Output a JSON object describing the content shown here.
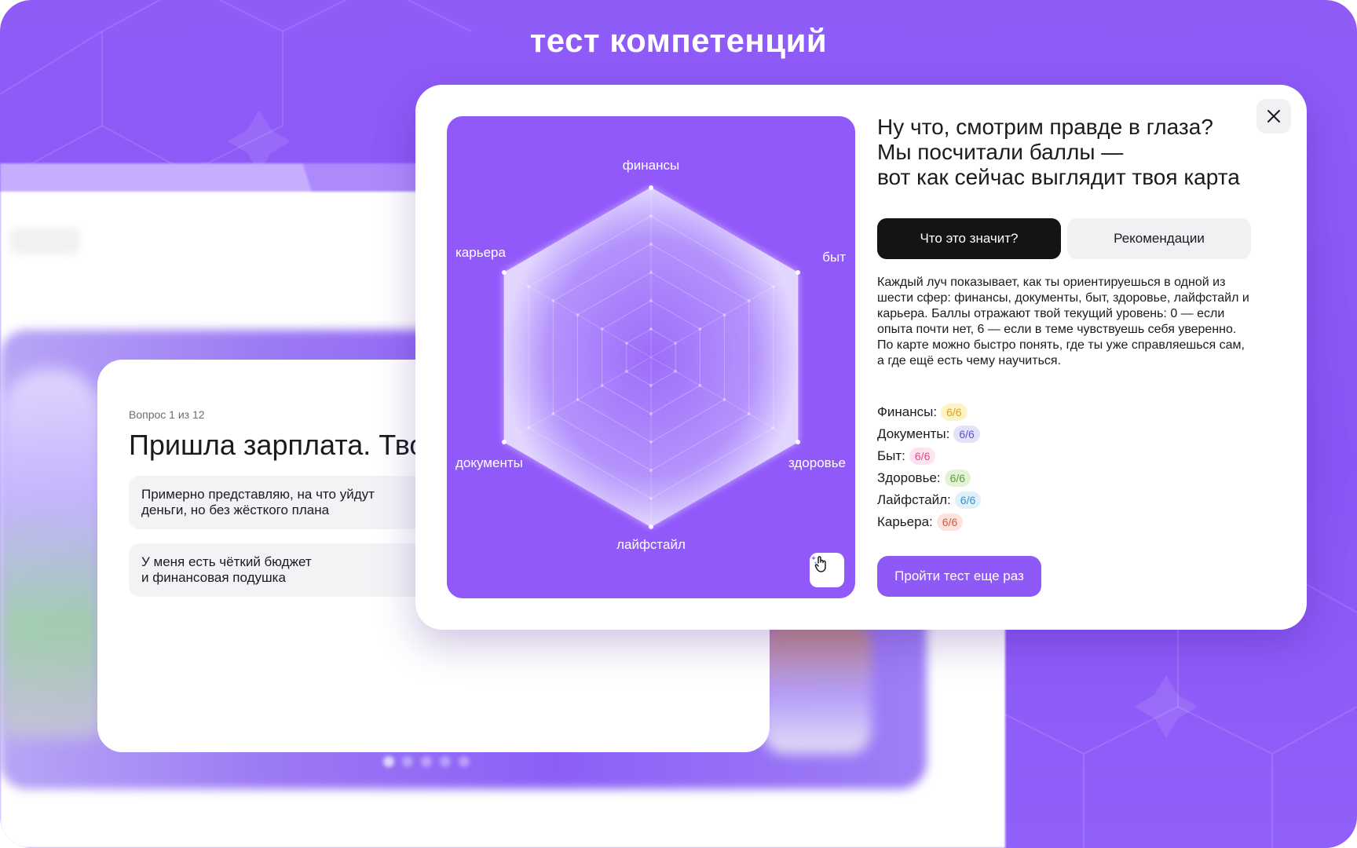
{
  "page": {
    "title": "тест компетенций"
  },
  "question_card": {
    "counter": "Вопрос 1 из 12",
    "title": "Пришла зарплата. Тво",
    "options": [
      "Примерно представляю, на что уйдут\nденьги, но без жёсткого плана",
      "У меня есть чёткий бюджет\nи финансовая подушка"
    ]
  },
  "modal": {
    "heading_lines": [
      "Ну что, смотрим правде в глаза?",
      "Мы посчитали баллы —",
      "вот как сейчас выглядит твоя карта"
    ],
    "tabs": [
      {
        "label": "Что это значит?",
        "active": true
      },
      {
        "label": "Рекомендации",
        "active": false
      }
    ],
    "description": "Каждый луч показывает, как ты ориентируешься в одной из шести сфер: финансы, документы, быт, здоровье, лайфстайл и карьера. Баллы отражают твой текущий уровень: 0 — если опыта почти нет, 6 — если в теме чувствуешь себя уверенно. По карте можно быстро понять, где ты уже справляешься сам, а где ещё есть чему научиться.",
    "scores": [
      {
        "label": "Финансы:",
        "value": "6/6",
        "bg": "#fdf3c4",
        "fg": "#d8a21a"
      },
      {
        "label": "Документы:",
        "value": "6/6",
        "bg": "#e3e1fb",
        "fg": "#5b55c8"
      },
      {
        "label": "Быт:",
        "value": "6/6",
        "bg": "#fde3ef",
        "fg": "#d6508c"
      },
      {
        "label": "Здоровье:",
        "value": "6/6",
        "bg": "#e2f4d6",
        "fg": "#5c9c3a"
      },
      {
        "label": "Лайфстайл:",
        "value": "6/6",
        "bg": "#dff0fb",
        "fg": "#3d8fc9"
      },
      {
        "label": "Карьера:",
        "value": "6/6",
        "bg": "#fde3dc",
        "fg": "#d15a44"
      }
    ],
    "retry_label": "Пройти тест еще раз",
    "close_icon": "close-icon",
    "hint_icon": "tap-sparkle-icon"
  },
  "chart_data": {
    "type": "radar",
    "axes": [
      "финансы",
      "быт",
      "здоровье",
      "лайфстайл",
      "документы",
      "карьера"
    ],
    "values": [
      6,
      6,
      6,
      6,
      6,
      6
    ],
    "range": [
      0,
      6
    ],
    "grid_levels": 6,
    "colors": {
      "panel": "#9158fa",
      "fill": "#ffffff"
    }
  }
}
